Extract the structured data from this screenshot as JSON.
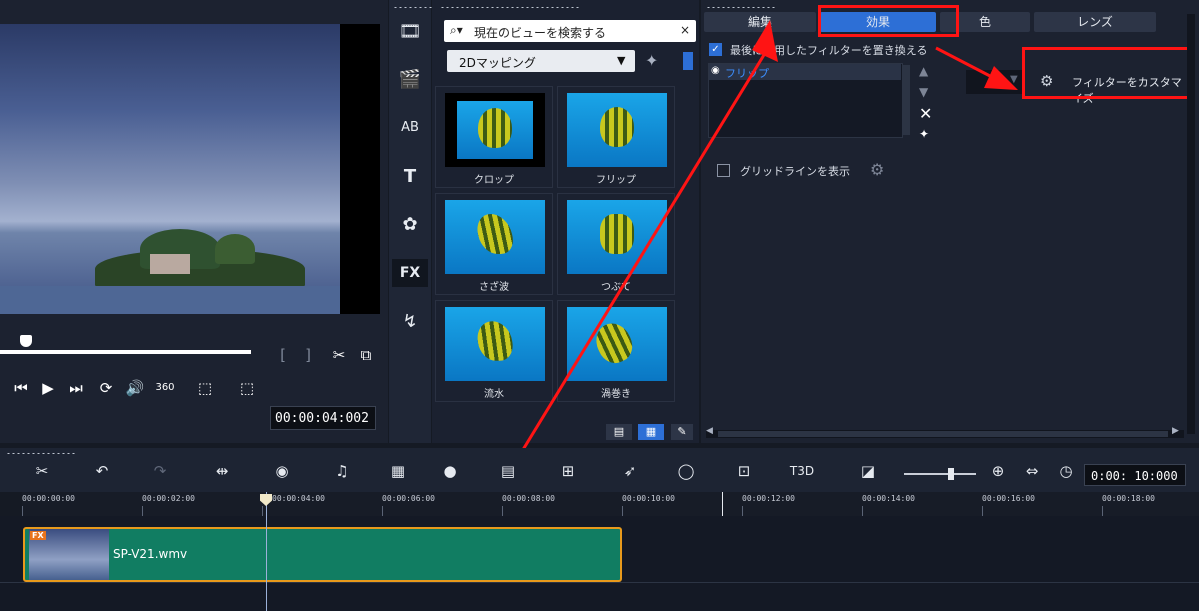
{
  "library": {
    "search_placeholder": "現在のビューを検索する",
    "category": "2Dマッピング",
    "thumbnails": [
      {
        "label": "クロップ"
      },
      {
        "label": "フリップ"
      },
      {
        "label": "さざ波"
      },
      {
        "label": "つぶて"
      },
      {
        "label": "流水"
      },
      {
        "label": "渦巻き"
      }
    ]
  },
  "options": {
    "tabs": [
      {
        "label": "編集"
      },
      {
        "label": "効果"
      },
      {
        "label": "色"
      },
      {
        "label": "レンズ"
      }
    ],
    "replace_filter_label": "最後に使用したフィルターを置き換える",
    "applied_filter": "フリップ",
    "customize_filter_label": "フィルターをカスタマイズ",
    "gridline_label": "グリッドラインを表示"
  },
  "preview": {
    "timecode": "00:00:04:002"
  },
  "timeline": {
    "zoom_timecode": "0:00: 10:000",
    "ruler": [
      "00:00:00:00",
      "00:00:02:00",
      "00:00:04:00",
      "00:00:06:00",
      "00:00:08:00",
      "00:00:10:00",
      "00:00:12:00",
      "00:00:14:00",
      "00:00:16:00",
      "00:00:18:00"
    ],
    "clip": {
      "name": "SP-V21.wmv",
      "badge": "FX"
    }
  },
  "colors": {
    "accent": "#2d6fd6",
    "annotation_red": "#ff1414",
    "clip": "#117d62"
  }
}
